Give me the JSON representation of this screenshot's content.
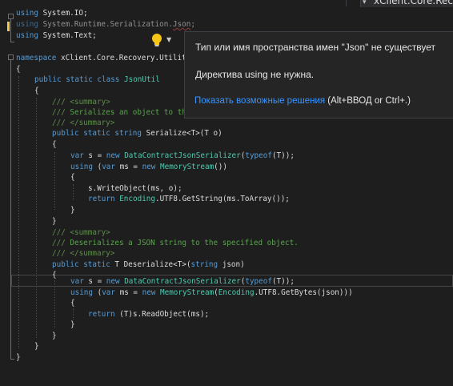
{
  "tab": {
    "label": "xClient.Core.Recov"
  },
  "popup": {
    "message": "Тип или имя пространства имен \"Json\" не существует",
    "directive": "Директива using не нужна.",
    "link": "Показать возможные решения",
    "shortcut": "(Alt+ВВОД or Ctrl+.)"
  },
  "colors": {
    "keyword": "#569cd6",
    "type": "#4ec9b0",
    "comment": "#57a64a",
    "link": "#3794ff",
    "marker": "#f2c94c"
  },
  "icons": [
    "lightbulb-icon",
    "chevron-down-icon",
    "collapse-icon"
  ],
  "code": {
    "l1": {
      "kw": "using",
      "rest": " System.IO;"
    },
    "l2": {
      "kw": "using",
      "rest": " System.Runtime.Serialization.",
      "err": "Json",
      "end": ";"
    },
    "l3": {
      "kw": "using",
      "rest": " System.Text;"
    },
    "l4": {
      "kw": "namespace",
      "rest": " xClient.Core.Recovery.Utilit"
    },
    "l5": {
      "text": "{"
    },
    "l6": {
      "kw1": "public",
      "kw2": "static",
      "kw3": "class",
      "name": "JsonUtil"
    },
    "l7": {
      "text": "{"
    },
    "l8": {
      "a": "/// ",
      "tag": "<summary>"
    },
    "l9": {
      "a": "/// ",
      "text": "Serializes an object to th"
    },
    "l10": {
      "a": "/// ",
      "tag": "</summary>"
    },
    "l11": {
      "kw1": "public",
      "kw2": "static",
      "kw3": "string",
      "name": " Serialize<T>(T o)"
    },
    "l12": {
      "text": "{"
    },
    "l13": {
      "kw": "var",
      "a": " s = ",
      "kw2": "new",
      "b": " ",
      "ty": "DataContractJsonSerializer",
      "c": "(",
      "kw3": "typeof",
      "d": "(T));"
    },
    "l14": {
      "kw": "using",
      "a": " (",
      "kw2": "var",
      "b": " ms = ",
      "kw3": "new",
      "c": " ",
      "ty": "MemoryStream",
      "d": "())"
    },
    "l15": {
      "text": "{"
    },
    "l16": {
      "text": "s.WriteObject(ms, o);"
    },
    "l17": {
      "kw": "return",
      "a": " ",
      "ty": "Encoding",
      "b": ".UTF8.GetString(ms.ToArray());"
    },
    "l18": {
      "text": "}"
    },
    "l19": {
      "text": "}"
    },
    "l20": {
      "a": "/// ",
      "tag": "<summary>"
    },
    "l21": {
      "a": "/// ",
      "text": "Deserializes a JSON string to the specified object."
    },
    "l22": {
      "a": "/// ",
      "tag": "</summary>"
    },
    "l23": {
      "kw1": "public",
      "kw2": "static",
      "a": " T Deserialize<T>(",
      "kw3": "string",
      "b": " json)"
    },
    "l24": {
      "text": "{"
    },
    "l25": {
      "kw": "var",
      "a": " s = ",
      "kw2": "new",
      "b": " ",
      "ty": "DataContractJsonSerializer",
      "c": "(",
      "kw3": "typeof",
      "d": "(T));"
    },
    "l26": {
      "kw": "using",
      "a": " (",
      "kw2": "var",
      "b": " ms = ",
      "kw3": "new",
      "c": " ",
      "ty": "MemoryStream",
      "d": "(",
      "ty2": "Encoding",
      "e": ".UTF8.GetBytes(json)))"
    },
    "l27": {
      "text": "{"
    },
    "l28": {
      "kw": "return",
      "a": " (T)s.ReadObject(ms);"
    },
    "l29": {
      "text": "}"
    },
    "l30": {
      "text": "}"
    },
    "l31": {
      "text": "}"
    },
    "l32": {
      "text": "}"
    }
  }
}
